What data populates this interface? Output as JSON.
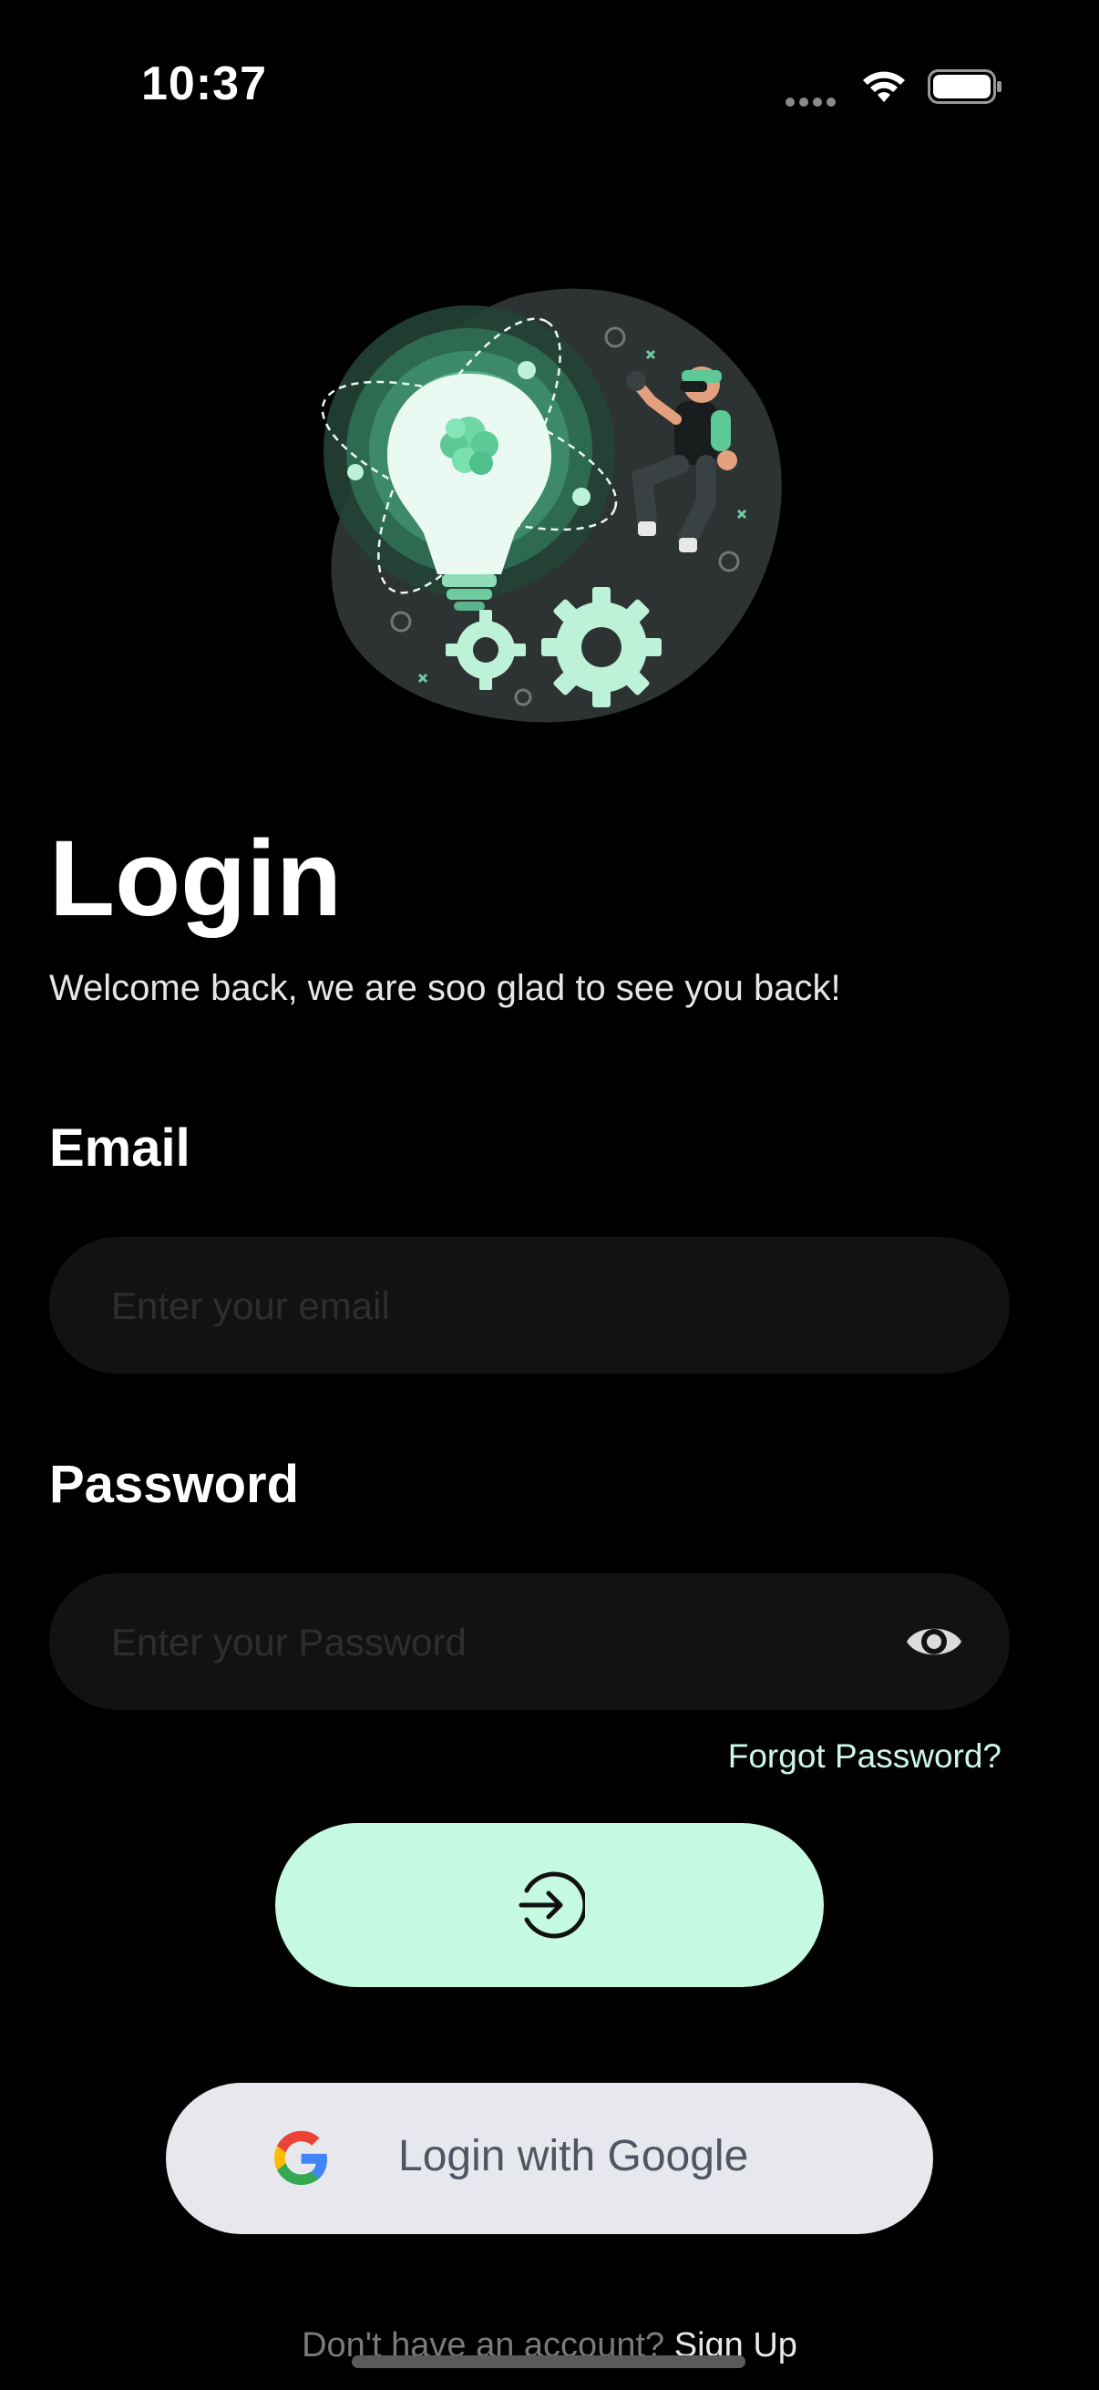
{
  "status_bar": {
    "time": "10:37"
  },
  "header": {
    "title": "Login",
    "subtitle": "Welcome back, we are soo glad to see you back!"
  },
  "form": {
    "email_label": "Email",
    "email_placeholder": "Enter your email",
    "email_value": "",
    "password_label": "Password",
    "password_placeholder": "Enter your Password",
    "password_value": "",
    "forgot_password": "Forgot Password?"
  },
  "actions": {
    "login_icon": "arrow-right-circle-icon",
    "google_label": "Login with Google",
    "google_icon": "google-logo-icon"
  },
  "footer": {
    "signup_prompt": "Don't have an account?",
    "signup_link": "Sign Up"
  },
  "colors": {
    "background": "#000000",
    "accent_mint": "#c6f9e1",
    "input_background": "#121212",
    "google_button": "#e6e8ed"
  }
}
